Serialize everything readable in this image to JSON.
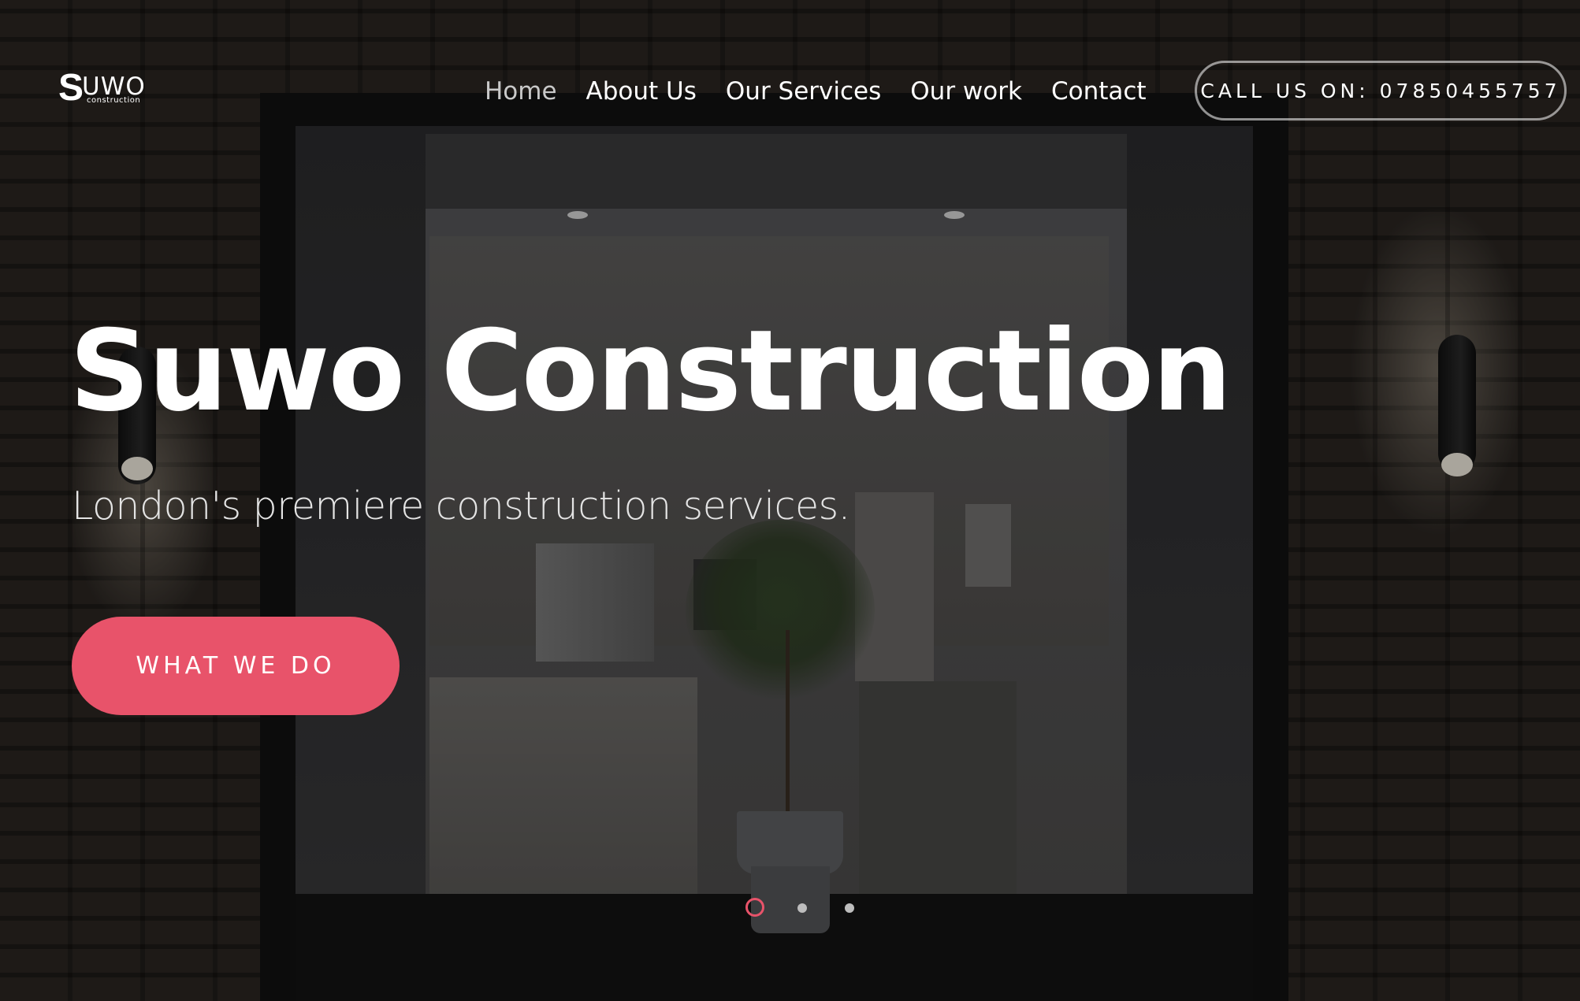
{
  "brand": {
    "logo_initial": "S",
    "logo_text": "UWO",
    "logo_subtext": "construction"
  },
  "nav": {
    "items": [
      {
        "label": "Home",
        "active": true
      },
      {
        "label": "About Us",
        "active": false
      },
      {
        "label": "Our Services",
        "active": false
      },
      {
        "label": "Our work",
        "active": false
      },
      {
        "label": "Contact",
        "active": false
      }
    ]
  },
  "header": {
    "call_label": "CALL US ON: 07850455757"
  },
  "hero": {
    "title": "Suwo Construction",
    "subtitle": "London's premiere construction services.",
    "cta_label": "WHAT WE DO",
    "slides_total": 3,
    "active_slide": 1
  },
  "colors": {
    "accent": "#e8536a",
    "text": "#ffffff",
    "nav_active": "#c9c9c9"
  }
}
